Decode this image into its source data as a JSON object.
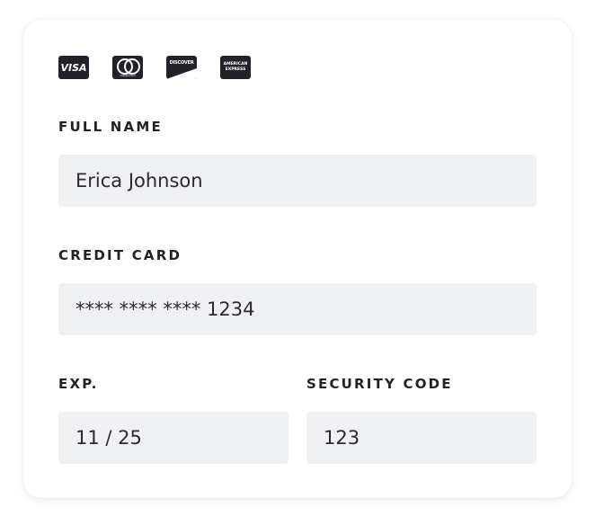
{
  "card_brands": [
    {
      "name": "VISA",
      "icon": "visa-icon"
    },
    {
      "name": "mastercard",
      "icon": "mastercard-icon"
    },
    {
      "name": "DISCOVER",
      "icon": "discover-icon"
    },
    {
      "name": "AMERICAN EXPRESS",
      "icon": "amex-icon",
      "line1": "AMERICAN",
      "line2": "EXPRESS"
    }
  ],
  "fields": {
    "full_name": {
      "label": "FULL NAME",
      "value": "Erica Johnson"
    },
    "credit_card": {
      "label": "CREDIT CARD",
      "value": "**** **** **** 1234"
    },
    "exp": {
      "label": "EXP.",
      "value": "11 / 25"
    },
    "security_code": {
      "label": "SECURITY CODE",
      "value": "123"
    }
  },
  "colors": {
    "field_bg": "#f0f1f3",
    "text": "#222228",
    "logo_bg": "#22222a"
  }
}
